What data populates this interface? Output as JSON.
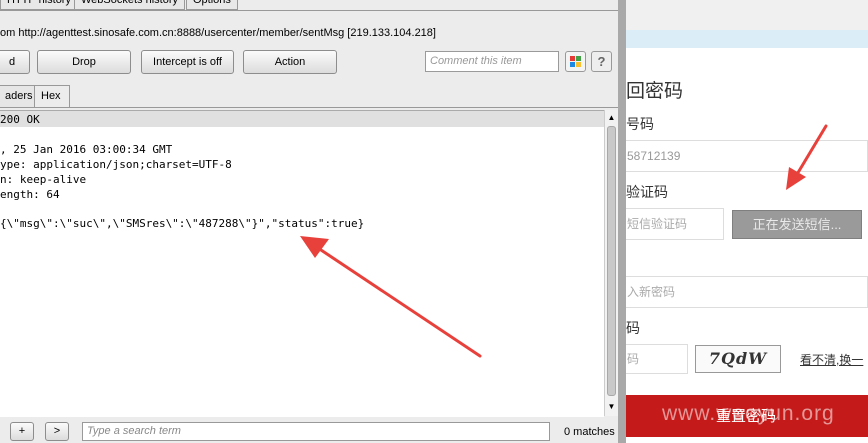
{
  "burp": {
    "top_tabs": [
      "HTTP history",
      "WebSockets history",
      "Options"
    ],
    "url_line": "om http://agenttest.sinosafe.com.cn:8888/usercenter/member/sentMsg  [219.133.104.218]",
    "buttons": {
      "forward": "d",
      "drop": "Drop",
      "intercept": "Intercept is off",
      "action": "Action"
    },
    "comment_placeholder": "Comment this item",
    "help_label": "?",
    "sub_tabs": [
      "aders",
      "Hex"
    ],
    "response_lines": [
      "200 OK",
      "",
      ", 25 Jan 2016 03:00:34 GMT",
      "ype: application/json;charset=UTF-8",
      "n: keep-alive",
      "ength: 64",
      "",
      "{\\\"msg\\\":\\\"suc\\\",\\\"SMSres\\\":\\\"487288\\\"}\",\"status\":true}"
    ],
    "search": {
      "plus": "+",
      "next": ">",
      "placeholder": "Type a search term",
      "matches": "0 matches"
    }
  },
  "web": {
    "title": "回密码",
    "phone_label": "号码",
    "phone_value": "58712139",
    "sms_label": "验证码",
    "sms_placeholder": "短信验证码",
    "send_button": "正在发送短信...",
    "newpwd_placeholder": "入新密码",
    "captcha_label": "码",
    "captcha_placeholder": "码",
    "captcha_text": "7QdW",
    "swap_link": "看不清,换一",
    "reset_button": "重置密码",
    "watermark": "www.wooyun.org"
  },
  "colors": {
    "arrow": "#e8413c",
    "reset": "#c41a1a",
    "send_disabled": "#9a9a9a",
    "blue_strip": "#dbeef8"
  }
}
